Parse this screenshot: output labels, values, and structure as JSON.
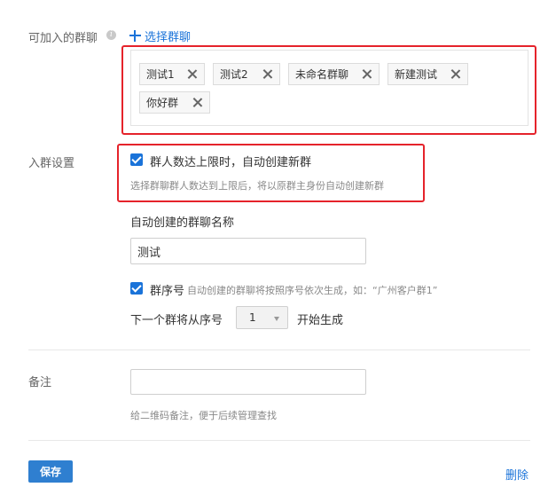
{
  "joinable_groups": {
    "label": "可加入的群聊",
    "info_icon": "i",
    "select_link": "选择群聊",
    "tags": [
      {
        "label": "测试1"
      },
      {
        "label": "测试2"
      },
      {
        "label": "未命名群聊"
      },
      {
        "label": "新建测试"
      },
      {
        "label": "你好群"
      }
    ]
  },
  "join_settings": {
    "label": "入群设置",
    "auto_create_checkbox_label": "群人数达上限时，自动创建新群",
    "auto_create_checked": true,
    "auto_create_hint": "选择群聊群人数达到上限后，将以原群主身份自动创建新群",
    "auto_name_label": "自动创建的群聊名称",
    "auto_name_value": "测试",
    "seq_checkbox_label": "群序号",
    "seq_checked": true,
    "seq_hint": "自动创建的群聊将按照序号依次生成，如：“广州客户群1”",
    "next_prefix": "下一个群将从序号",
    "next_value": "1",
    "next_suffix": "开始生成"
  },
  "remark": {
    "label": "备注",
    "value": "",
    "hint": "给二维码备注，便于后续管理查找"
  },
  "actions": {
    "save_label": "保存",
    "delete_label": "删除"
  },
  "colors": {
    "accent": "#1a73d9",
    "highlight_border": "#e5232b",
    "save_button": "#2f7fd0"
  }
}
